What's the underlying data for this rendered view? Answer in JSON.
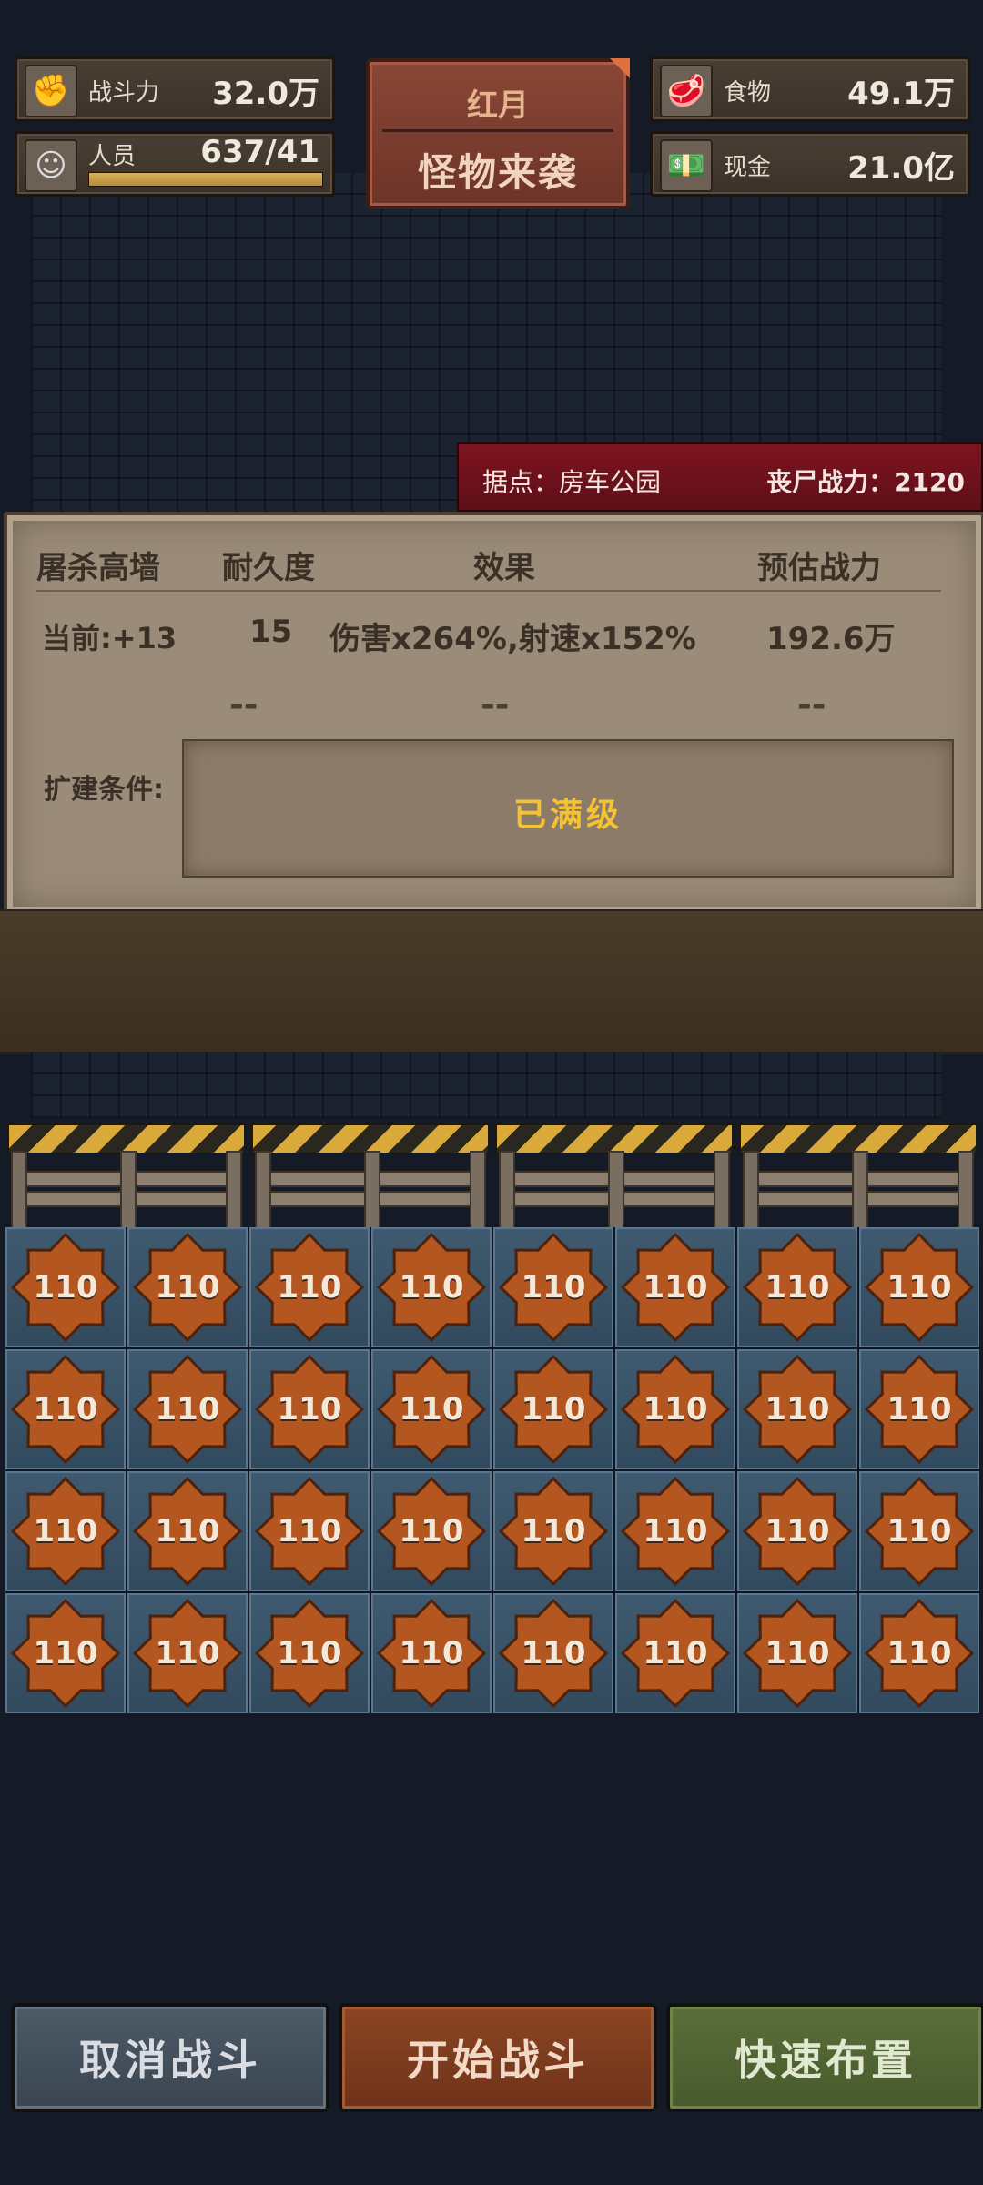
{
  "stats": {
    "combat": {
      "label": "战斗力",
      "value": "32.0万",
      "icon": "fist-icon"
    },
    "personnel": {
      "label": "人员",
      "value": "637/41",
      "icon": "person-icon",
      "bar_fill": 1.0
    },
    "food": {
      "label": "食物",
      "value": "49.1万",
      "icon": "meat-icon"
    },
    "cash": {
      "label": "现金",
      "value": "21.0亿",
      "icon": "cash-icon"
    }
  },
  "event": {
    "title": "红月",
    "subtitle": "怪物来袭"
  },
  "location": {
    "label": "据点：房车公园",
    "zombie_power": "丧尸战力：2120"
  },
  "panel": {
    "headers": [
      "屠杀高墙",
      "耐久度",
      "效果",
      "预估战力"
    ],
    "current": [
      "当前:+13",
      "15",
      "伤害x264%,射速x152%",
      "192.6万"
    ],
    "next": [
      "--",
      "--",
      "--"
    ],
    "condition_label": "扩建条件:",
    "condition_text": "已满级"
  },
  "grid": {
    "tiles": [
      "110",
      "110",
      "110",
      "110",
      "110",
      "110",
      "110",
      "110",
      "110",
      "110",
      "110",
      "110",
      "110",
      "110",
      "110",
      "110",
      "110",
      "110",
      "110",
      "110",
      "110",
      "110",
      "110",
      "110",
      "110",
      "110",
      "110",
      "110",
      "110",
      "110",
      "110",
      "110"
    ]
  },
  "buttons": {
    "cancel": "取消战斗",
    "start": "开始战斗",
    "quick": "快速布置"
  },
  "colors": {
    "accent_yellow": "#f5c232",
    "banner_red": "#7d1420",
    "tile_blue": "#3f5a70",
    "badge_orange": "#b4561f"
  }
}
